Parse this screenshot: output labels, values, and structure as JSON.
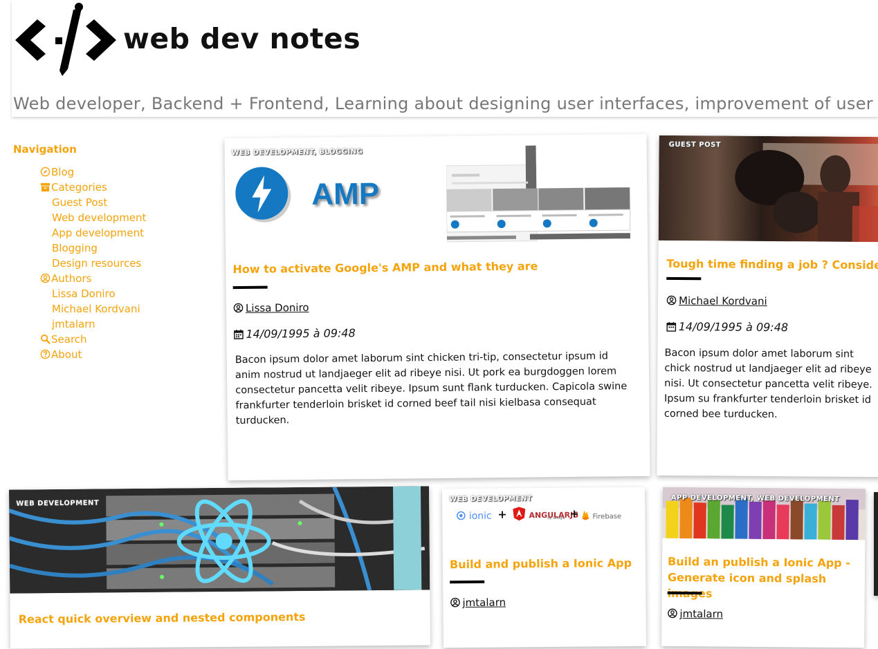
{
  "site": {
    "title": "web dev notes",
    "tagline": "Web developer, Backend + Frontend, Learning about designing user interfaces, improvement of user expe"
  },
  "nav": {
    "title": "Navigation",
    "items": [
      {
        "label": "Blog",
        "icon": "compass-icon"
      },
      {
        "label": "Categories",
        "icon": "archive-icon"
      },
      {
        "label": "Guest Post"
      },
      {
        "label": "Web development"
      },
      {
        "label": "App development"
      },
      {
        "label": "Blogging"
      },
      {
        "label": "Design resources"
      },
      {
        "label": "Authors",
        "icon": "user-circle-icon"
      },
      {
        "label": "Lissa Doniro"
      },
      {
        "label": "Michael Kordvani"
      },
      {
        "label": "jmtalarn"
      },
      {
        "label": "Search",
        "icon": "search-icon"
      },
      {
        "label": "About",
        "icon": "question-circle-icon"
      }
    ]
  },
  "posts": [
    {
      "category": "WEB DEVELOPMENT, BLOGGING",
      "image_text": "AMP",
      "title": "How to activate Google's AMP and what they are",
      "author": "Lissa Doniro",
      "date": "14/09/1995 à 09:48",
      "excerpt": "Bacon ipsum dolor amet laborum sint chicken tri-tip, consectetur ipsum id anim nostrud ut landjaeger elit ad ribeye nisi. Ut pork ea burgdoggen lorem consectetur pancetta velit ribeye. Ipsum sunt flank turducken. Capicola swine frankfurter tenderloin brisket id corned beef tail nisi kielbasa consequat turducken."
    },
    {
      "category": "GUEST POST",
      "title": "Tough time finding a job ? Consider be",
      "author": "Michael Kordvani",
      "date": "14/09/1995 à 09:48",
      "excerpt": "Bacon ipsum dolor amet laborum sint chick nostrud ut landjaeger elit ad ribeye nisi. Ut consectetur pancetta velit ribeye. Ipsum su frankfurter tenderloin brisket id corned bee turducken."
    },
    {
      "category": "WEB DEVELOPMENT",
      "title": "React quick overview and nested components"
    },
    {
      "category": "WEB DEVELOPMENT",
      "logos": {
        "ionic": "ionic",
        "angular": "ANGULARJS",
        "angular_sub": "by Google",
        "firebase": "Firebase"
      },
      "title": "Build and publish a Ionic App",
      "author": "jmtalarn"
    },
    {
      "category": "APP DEVELOPMENT, WEB DEVELOPMENT",
      "title": "Build an publish a Ionic App - Generate icon and splash images",
      "author": "jmtalarn"
    }
  ],
  "colors": {
    "accent": "#f5a30b",
    "text": "#111111",
    "tagline": "#777777",
    "amp_blue": "#1478c3"
  }
}
